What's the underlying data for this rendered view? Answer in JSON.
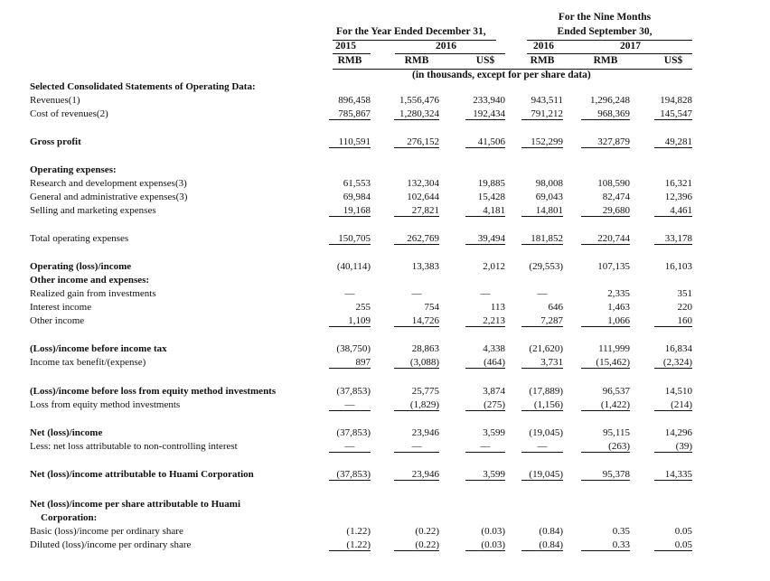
{
  "header": {
    "year_ended": "For the Year Ended December 31,",
    "nine_months_l1": "For the Nine Months",
    "nine_months_l2": "Ended September 30,",
    "year_2015": "2015",
    "year_2016": "2016",
    "year_2016b": "2016",
    "year_2017": "2017",
    "currency": [
      "RMB",
      "RMB",
      "US$",
      "RMB",
      "RMB",
      "US$"
    ],
    "units_note": "(in thousands, except for per share data)"
  },
  "rows": [
    {
      "label": "Selected Consolidated Statements of Operating Data:",
      "bold": true,
      "values": []
    },
    {
      "label": "Revenues(1)",
      "values": [
        "896,458",
        "1,556,476",
        "233,940",
        "943,511",
        "1,296,248",
        "194,828"
      ]
    },
    {
      "label": "Cost of revenues(2)",
      "values": [
        "785,867",
        "1,280,324",
        "192,434",
        "791,212",
        "968,369",
        "145,547"
      ],
      "under": true
    },
    {
      "label": "Gross profit",
      "bold": true,
      "values": [
        "110,591",
        "276,152",
        "41,506",
        "152,299",
        "327,879",
        "49,281"
      ],
      "under": true
    },
    {
      "label": "Operating expenses:",
      "bold": true,
      "values": []
    },
    {
      "label": "Research and development expenses(3)",
      "values": [
        "61,553",
        "132,304",
        "19,885",
        "98,008",
        "108,590",
        "16,321"
      ]
    },
    {
      "label": "General and administrative expenses(3)",
      "values": [
        "69,984",
        "102,644",
        "15,428",
        "69,043",
        "82,474",
        "12,396"
      ]
    },
    {
      "label": "Selling and marketing expenses",
      "values": [
        "19,168",
        "27,821",
        "4,181",
        "14,801",
        "29,680",
        "4,461"
      ],
      "under": true
    },
    {
      "label": "Total operating expenses",
      "values": [
        "150,705",
        "262,769",
        "39,494",
        "181,852",
        "220,744",
        "33,178"
      ],
      "under": true
    },
    {
      "label": "Operating (loss)/income",
      "bold": true,
      "values": [
        "(40,114)",
        "13,383",
        "2,012",
        "(29,553)",
        "107,135",
        "16,103"
      ]
    },
    {
      "label": "Other income and expenses:",
      "bold": true,
      "values": []
    },
    {
      "label": "Realized gain from investments",
      "values": [
        "—",
        "—",
        "—",
        "—",
        "2,335",
        "351"
      ]
    },
    {
      "label": "Interest income",
      "values": [
        "255",
        "754",
        "113",
        "646",
        "1,463",
        "220"
      ]
    },
    {
      "label": "Other income",
      "values": [
        "1,109",
        "14,726",
        "2,213",
        "7,287",
        "1,066",
        "160"
      ],
      "under": true
    },
    {
      "label": "(Loss)/income before income tax",
      "bold": true,
      "values": [
        "(38,750)",
        "28,863",
        "4,338",
        "(21,620)",
        "111,999",
        "16,834"
      ]
    },
    {
      "label": "Income tax benefit/(expense)",
      "values": [
        "897",
        "(3,088)",
        "(464)",
        "3,731",
        "(15,462)",
        "(2,324)"
      ],
      "under": true
    },
    {
      "label": "(Loss)/income before loss from equity method investments",
      "bold": true,
      "values": [
        "(37,853)",
        "25,775",
        "3,874",
        "(17,889)",
        "96,537",
        "14,510"
      ]
    },
    {
      "label": "Loss from equity method investments",
      "values": [
        "—",
        "(1,829)",
        "(275)",
        "(1,156)",
        "(1,422)",
        "(214)"
      ],
      "under": true
    },
    {
      "label": "Net (loss)/income",
      "bold": true,
      "values": [
        "(37,853)",
        "23,946",
        "3,599",
        "(19,045)",
        "95,115",
        "14,296"
      ]
    },
    {
      "label": "Less: net loss attributable to non-controlling interest",
      "values": [
        "—",
        "—",
        "—",
        "—",
        "(263)",
        "(39)"
      ],
      "under": true
    },
    {
      "label": "Net (loss)/income attributable to Huami Corporation",
      "bold": true,
      "values": [
        "(37,853)",
        "23,946",
        "3,599",
        "(19,045)",
        "95,378",
        "14,335"
      ],
      "under": true
    },
    {
      "label": "Net (loss)/income per share attributable to Huami",
      "bold": true,
      "values": []
    },
    {
      "label": "Corporation:",
      "bold": true,
      "indent": true,
      "values": []
    },
    {
      "label": "Basic (loss)/income per ordinary share",
      "values": [
        "(1.22)",
        "(0.22)",
        "(0.03)",
        "(0.84)",
        "0.35",
        "0.05"
      ]
    },
    {
      "label": "Diluted (loss)/income per ordinary share",
      "values": [
        "(1.22)",
        "(0.22)",
        "(0.03)",
        "(0.84)",
        "0.33",
        "0.05"
      ],
      "under": true
    }
  ]
}
